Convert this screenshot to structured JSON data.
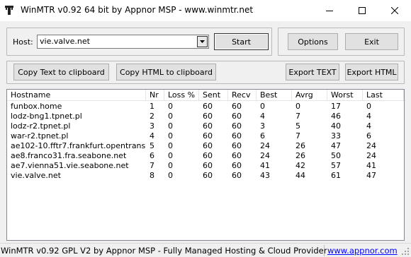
{
  "window": {
    "title": "WinMTR v0.92 64 bit by Appnor MSP - www.winmtr.net"
  },
  "host": {
    "label": "Host:",
    "value": "vie.valve.net"
  },
  "buttons": {
    "start": "Start",
    "options": "Options",
    "exit": "Exit",
    "copy_text": "Copy Text to clipboard",
    "copy_html": "Copy HTML to clipboard",
    "export_text": "Export TEXT",
    "export_html": "Export HTML"
  },
  "table": {
    "columns": [
      "Hostname",
      "Nr",
      "Loss %",
      "Sent",
      "Recv",
      "Best",
      "Avrg",
      "Worst",
      "Last"
    ],
    "rows": [
      [
        "funbox.home",
        "1",
        "0",
        "60",
        "60",
        "0",
        "0",
        "17",
        "0"
      ],
      [
        "lodz-bng1.tpnet.pl",
        "2",
        "0",
        "60",
        "60",
        "4",
        "7",
        "46",
        "4"
      ],
      [
        "lodz-r2.tpnet.pl",
        "3",
        "0",
        "60",
        "60",
        "3",
        "5",
        "40",
        "4"
      ],
      [
        "war-r2.tpnet.pl",
        "4",
        "0",
        "60",
        "60",
        "6",
        "7",
        "33",
        "6"
      ],
      [
        "ae102-10.fftr7.frankfurt.opentransit.net",
        "5",
        "0",
        "60",
        "60",
        "24",
        "26",
        "47",
        "24"
      ],
      [
        "ae8.franco31.fra.seabone.net",
        "6",
        "0",
        "60",
        "60",
        "24",
        "26",
        "50",
        "24"
      ],
      [
        "ae7.vienna51.vie.seabone.net",
        "7",
        "0",
        "60",
        "60",
        "41",
        "42",
        "57",
        "41"
      ],
      [
        "vie.valve.net",
        "8",
        "0",
        "60",
        "60",
        "43",
        "44",
        "61",
        "47"
      ]
    ]
  },
  "status": {
    "text": "WinMTR v0.92 GPL V2 by Appnor MSP - Fully Managed Hosting & Cloud Provider",
    "link": "www.appnor.com"
  }
}
